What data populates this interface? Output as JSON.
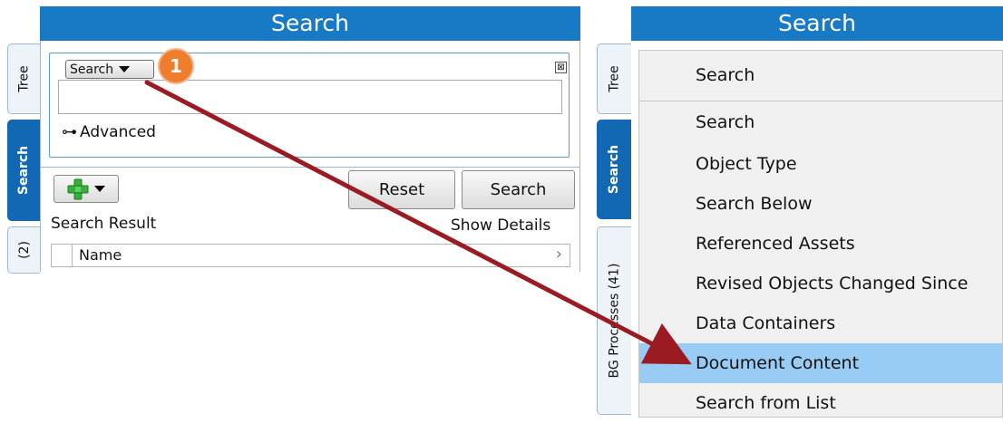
{
  "left": {
    "title": "Search",
    "tabs": {
      "tree": "Tree",
      "search": "Search",
      "count": "(2)"
    },
    "combo_label": "Search",
    "close_glyph": "⊠",
    "badge": "1",
    "advanced_icon": "⊶",
    "advanced_label": "Advanced",
    "reset_label": "Reset",
    "search_label": "Search",
    "result_label": "Search Result",
    "details_label": "Show Details",
    "column_name": "Name",
    "column_chevron": "›"
  },
  "right": {
    "title": "Search",
    "tabs": {
      "tree": "Tree",
      "search": "Search",
      "bg": "BG Processes (41)"
    },
    "menu_header": "Search",
    "menu_items": [
      "Search",
      "Object Type",
      "Search Below",
      "Referenced Assets",
      "Revised Objects Changed Since",
      "Data Containers",
      "Document Content",
      "Search from List"
    ],
    "highlighted": "Document Content"
  },
  "colors": {
    "title_bar": "#1879c4",
    "active_tab": "#1268b3",
    "highlight": "#99ccf5",
    "badge": "#ee7d2e",
    "arrow": "#9b1b23"
  },
  "icons": {
    "add": "plus-icon",
    "dropdown": "chevron-down-icon",
    "advanced": "key-icon",
    "close": "close-icon"
  }
}
